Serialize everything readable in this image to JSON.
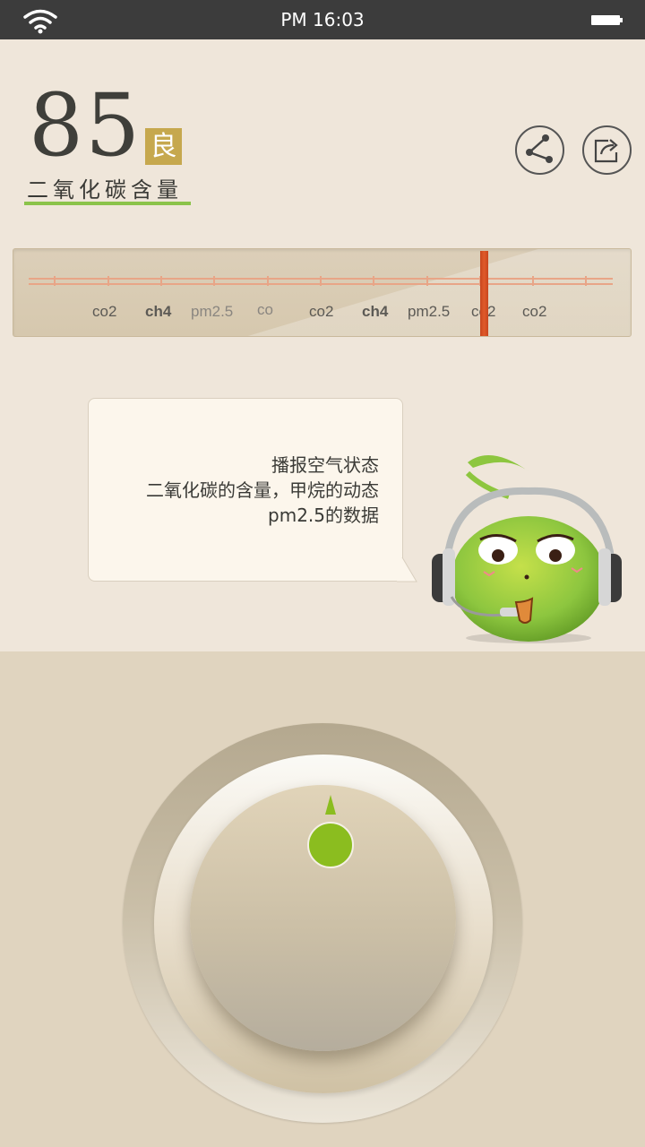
{
  "status_bar": {
    "time": "PM 16:03",
    "icons": [
      "wifi-icon",
      "battery-icon"
    ]
  },
  "reading": {
    "value": "85",
    "quality": "良",
    "label": "二氧化碳含量"
  },
  "actions": {
    "icons": [
      "share-icon",
      "export-icon"
    ]
  },
  "tuner": {
    "labels": [
      "co2",
      "ch4",
      "pm2.5",
      "co",
      "co2",
      "ch4",
      "pm2.5",
      "co2",
      "co2"
    ]
  },
  "bubble": {
    "lines": [
      "播报空气状态",
      "二氧化碳的含量，甲烷的动态",
      "pm2.5的数据"
    ]
  },
  "colors": {
    "accent_green": "#8bc34a",
    "badge_gold": "#c6a84e",
    "needle_red": "#e05a2a",
    "indicator_green": "#8bbd1f"
  }
}
